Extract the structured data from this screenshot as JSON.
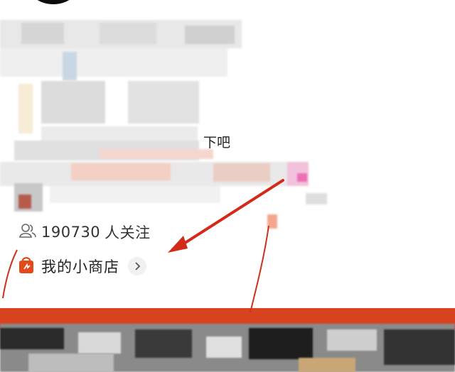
{
  "overlay_text": "下吧",
  "followers": {
    "count": "190730",
    "suffix": "人关注",
    "icon": "people-icon"
  },
  "shop": {
    "label": "我的小商店",
    "icon": "shopping-bag-icon",
    "chevron_icon": "chevron-right-icon"
  },
  "colors": {
    "accent": "#e24a1b",
    "annotation_arrow": "#d42a1a",
    "pink_badge": "#ec6fb4"
  }
}
